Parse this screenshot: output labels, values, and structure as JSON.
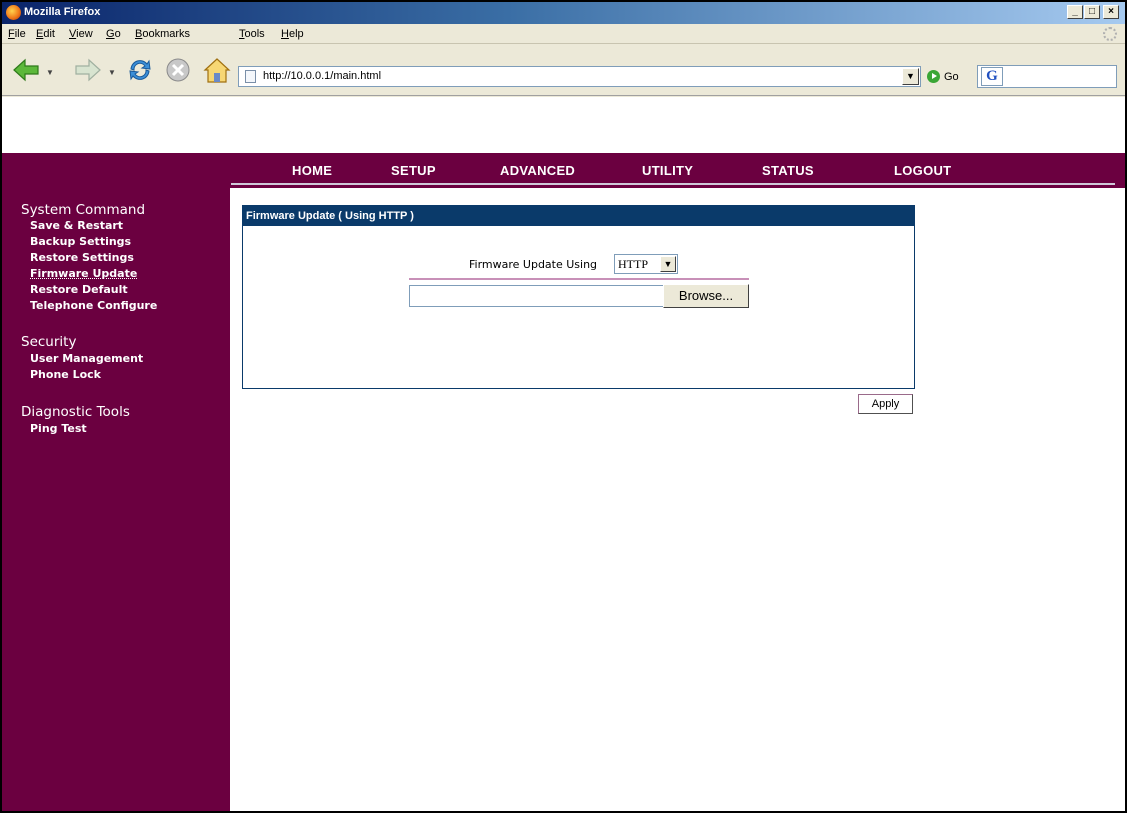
{
  "window": {
    "title": "Mozilla Firefox",
    "controls": [
      "minimize",
      "maximize",
      "close"
    ]
  },
  "menu": [
    {
      "label": "File",
      "accel": "F",
      "rest": "ile"
    },
    {
      "label": "Edit",
      "accel": "E",
      "rest": "dit"
    },
    {
      "label": "View",
      "accel": "V",
      "rest": "iew"
    },
    {
      "label": "Go",
      "accel": "G",
      "rest": "o"
    },
    {
      "label": "Bookmarks",
      "accel": "B",
      "rest": "ookmarks"
    },
    {
      "label": "Tools",
      "accel": "T",
      "rest": "ools"
    },
    {
      "label": "Help",
      "accel": "H",
      "rest": "elp"
    }
  ],
  "toolbar": {
    "url": "http://10.0.0.1/main.html",
    "go_label": "Go",
    "search_engine_icon": "google-icon"
  },
  "topnav": [
    "HOME",
    "SETUP",
    "ADVANCED",
    "UTILITY",
    "STATUS",
    "LOGOUT"
  ],
  "sidebar": {
    "sections": [
      {
        "title": "System Command",
        "links": [
          "Save & Restart",
          "Backup Settings",
          "Restore Settings",
          "Firmware Update",
          "Restore Default",
          "Telephone Configure"
        ]
      },
      {
        "title": "Security",
        "links": [
          "User Management",
          "Phone Lock"
        ]
      },
      {
        "title": "Diagnostic Tools",
        "links": [
          "Ping Test"
        ]
      }
    ],
    "active_link": "Firmware Update"
  },
  "panel": {
    "header": "Firmware Update ( Using HTTP )",
    "method_label": "Firmware Update Using",
    "method_value": "HTTP",
    "file_value": "",
    "browse_label": "Browse..."
  },
  "apply_label": "Apply",
  "colors": {
    "brand": "#6b0040",
    "panel_header": "#0a3a6a",
    "divider": "#c890b8"
  }
}
